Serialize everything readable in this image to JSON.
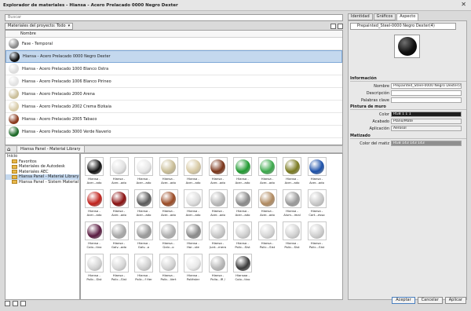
{
  "window": {
    "title": "Explorador de materiales - Hiansa - Acero Prelacado 0000 Negro Dexter",
    "close": "✕"
  },
  "search": {
    "placeholder": "Buscar"
  },
  "filter": {
    "label": "Materiales del proyecto: Todo",
    "arrow": "▾"
  },
  "list": {
    "column_header": "Nombre",
    "rows": [
      {
        "name": "Fase - Temporal",
        "color": "#8a8a8a"
      },
      {
        "name": "Hiansa - Acero Prelacado 0000 Negro Dexter",
        "color": "#111111",
        "selected": true
      },
      {
        "name": "Hiansa - Acero Prelacado 1000 Blanco Ostra",
        "color": "#dcdcdc"
      },
      {
        "name": "Hiansa - Acero Prelacado 1006 Blanco Pirineo",
        "color": "#e2e2e2"
      },
      {
        "name": "Hiansa - Acero Prelacado 2000 Arena",
        "color": "#cbbf9a"
      },
      {
        "name": "Hiansa - Acero Prelacado 2002 Crema Bizkaia",
        "color": "#d8cba8"
      },
      {
        "name": "Hiansa - Acero Prelacado 2005 Tabaco",
        "color": "#8a3a1e"
      },
      {
        "name": "Hiansa - Acero Prelacado 3000 Verde Naverio",
        "color": "#1f6b2a"
      }
    ]
  },
  "library": {
    "home_icon": "⌂",
    "breadcrumb": "Hiansa Panel - Material Library",
    "tree": [
      {
        "label": "Inicio",
        "level": 0
      },
      {
        "label": "Favoritos",
        "level": 1
      },
      {
        "label": "Materiales de Autodesk",
        "level": 1
      },
      {
        "label": "Materiales AEC",
        "level": 1
      },
      {
        "label": "Hiansa Panel - Material Library",
        "level": 1,
        "selected": true
      },
      {
        "label": "Hiansa Panel - Sistem Material Library",
        "level": 1
      }
    ],
    "items": [
      {
        "label": "Hiansa - Acer...ado",
        "color": "#111111"
      },
      {
        "label": "Hiansa - Acer...ado",
        "color": "#e0e0e0"
      },
      {
        "label": "Hiansa - Acer...ado",
        "color": "#e6e6e6"
      },
      {
        "label": "Hiansa - Acer...ado",
        "color": "#c9bd96"
      },
      {
        "label": "Hiansa - Acer...ado",
        "color": "#d7c9a3"
      },
      {
        "label": "Hiansa - Acer...ado",
        "color": "#7a3418"
      },
      {
        "label": "Hiansa - Acer...ado",
        "color": "#1f9a30"
      },
      {
        "label": "Hiansa - Acer...ado",
        "color": "#3aa84a"
      },
      {
        "label": "Hiansa - Acer...ado",
        "color": "#7a7a20"
      },
      {
        "label": "Hiansa - Acer...ado",
        "color": "#1a4fa8"
      },
      {
        "label": "Hiansa - Acer...ado",
        "color": "#c0201a"
      },
      {
        "label": "Hiansa - Acer...ado",
        "color": "#8a1010"
      },
      {
        "label": "Hiansa - Acer...ado",
        "color": "#5a5a5a"
      },
      {
        "label": "Hiansa - Acer...ado",
        "color": "#9a4a24"
      },
      {
        "label": "Hiansa - Acer...ado",
        "color": "#dcdcdc"
      },
      {
        "label": "Hiansa - Acer...ado",
        "color": "#b8b8b8"
      },
      {
        "label": "Hiansa - Acer...ado",
        "color": "#8a8a8a"
      },
      {
        "label": "Hiansa - Acer...ado",
        "color": "#b08a60"
      },
      {
        "label": "Hiansa - Alum...imal",
        "color": "#9a9a9a"
      },
      {
        "label": "Hiansa - Cart...esso",
        "color": "#c8c8c8"
      },
      {
        "label": "Hiansa - Colo...tivo",
        "color": "#5a1a40"
      },
      {
        "label": "Hiansa - Galv...ado",
        "color": "#a8a8a8"
      },
      {
        "label": "Hiansa - Galv...o",
        "color": "#9a9a9a"
      },
      {
        "label": "Hiansa - Galv...o",
        "color": "#b0b0b0"
      },
      {
        "label": "Hiansa - Hor...ste",
        "color": "#8a8a8a"
      },
      {
        "label": "Hiansa - Junt...mera",
        "color": "#c8c8c8"
      },
      {
        "label": "Hiansa - Polic...Sist",
        "color": "#d0d0d0"
      },
      {
        "label": "Hiansa - Polic...Sist",
        "color": "#d6d6d6"
      },
      {
        "label": "Hiansa - Polic...Sist",
        "color": "#d2d2d2"
      },
      {
        "label": "Hiansa - Polic...Sist",
        "color": "#cfcfcf"
      },
      {
        "label": "Hiansa - Polic...Sist",
        "color": "#d4d4d4"
      },
      {
        "label": "Hiansa - Polic...Sist",
        "color": "#d8d8d8"
      },
      {
        "label": "Hiansa - Polic...f Her",
        "color": "#d0d0d0"
      },
      {
        "label": "Hiansa - Polic...Vert",
        "color": "#d4d4d4"
      },
      {
        "label": "Hiansa - Poliéster",
        "color": "#e8e8e8"
      },
      {
        "label": "Hiansa - Polio...IR /",
        "color": "#b8b8b8"
      },
      {
        "label": "Hiansaa - Colo...tivo",
        "color": "#3a3a3a"
      }
    ]
  },
  "right": {
    "tabs": [
      "Identidad",
      "Gráficos",
      "Aspecto"
    ],
    "material_name": "Prepainted_Steel-0000 Negro Dexter(4)",
    "sections": {
      "info": "Información",
      "paint": "Pintura de muro",
      "tint": "Matizado"
    },
    "fields": {
      "name_label": "Nombre",
      "name_value": "Prepainted_Steel-0000 Negro Dexter(4)",
      "desc_label": "Descripción",
      "desc_value": "",
      "keywords_label": "Palabras clave",
      "keywords_value": "",
      "color_label": "Color",
      "color_value": "RGB 1 1 1",
      "finish_label": "Acabado",
      "finish_value": "Plano/Mate",
      "app_label": "Aplicación",
      "app_value": "Aerosol",
      "tintcolor_label": "Color del matiz",
      "tintcolor_value": "RGB 143 143 143"
    }
  },
  "buttons": {
    "accept": "Aceptar",
    "cancel": "Cancelar",
    "apply": "Aplicar"
  }
}
